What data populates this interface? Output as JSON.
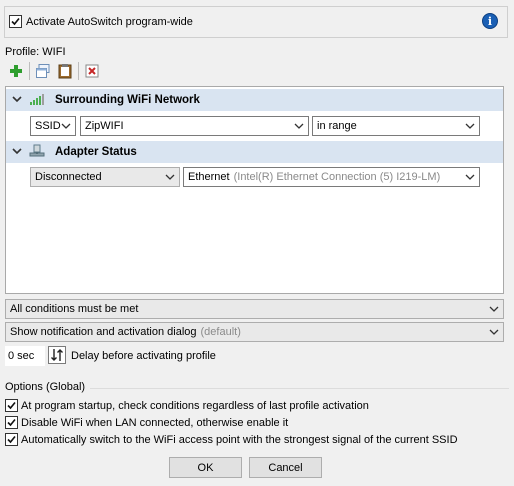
{
  "top": {
    "activate_label": "Activate AutoSwitch program-wide",
    "activate_checked": true,
    "info_icon": "info-icon"
  },
  "profile": {
    "label": "Profile: WIFI"
  },
  "toolbar": {
    "icons": [
      "add-icon",
      "copy-window-icon",
      "clipboard-icon",
      "delete-icon"
    ]
  },
  "conditions": {
    "wifi_group": {
      "title": "Surrounding WiFi Network",
      "icon": "wifi-signal-icon",
      "type_value": "SSID",
      "ssid_value": "ZipWIFI",
      "state_value": "in range"
    },
    "adapter_group": {
      "title": "Adapter Status",
      "icon": "network-adapter-icon",
      "status_value": "Disconnected",
      "adapter_name": "Ethernet",
      "adapter_desc": "(Intel(R) Ethernet Connection (5) I219-LM)"
    }
  },
  "logic": {
    "match_value": "All conditions must be met",
    "notify_value": "Show notification and activation dialog",
    "notify_suffix": "(default)"
  },
  "delay": {
    "value": "0 sec",
    "label": "Delay before activating profile"
  },
  "options": {
    "title": "Options (Global)",
    "items": [
      {
        "label": "At program startup, check conditions regardless of last profile activation",
        "checked": true
      },
      {
        "label": "Disable WiFi when LAN connected, otherwise enable it",
        "checked": true
      },
      {
        "label": "Automatically switch to the WiFi access point with the strongest signal of the current SSID",
        "checked": true
      }
    ]
  },
  "buttons": {
    "ok": "OK",
    "cancel": "Cancel"
  },
  "colors": {
    "group_header": "#d9e4f1",
    "info_blue": "#1a5fb4",
    "add_green": "#2e9e2e",
    "delete_red": "#c62828"
  }
}
